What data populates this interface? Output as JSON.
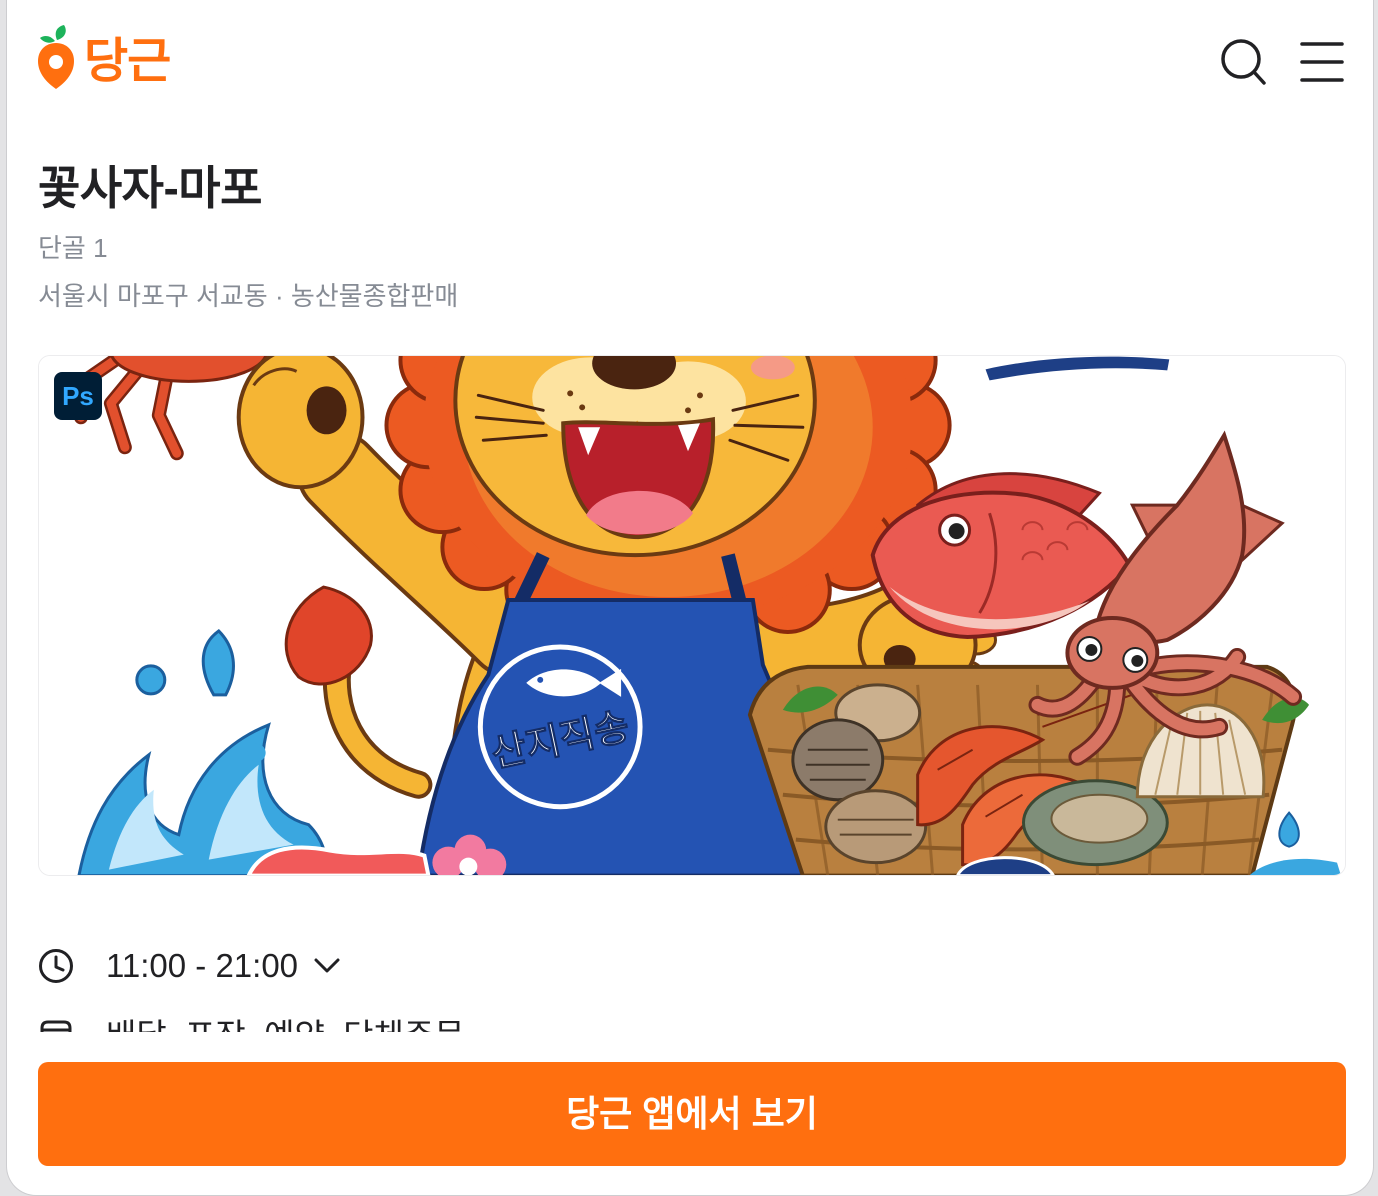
{
  "header": {
    "logo_text": "당근",
    "logo_icon": "carrot-logo-icon",
    "search_icon": "search-icon",
    "menu_icon": "hamburger-menu-icon"
  },
  "store": {
    "name": "꽃사자-마포",
    "regulars": "단골 1",
    "location_category": "서울시 마포구 서교동 · 농산물종합판매"
  },
  "hero_image": {
    "badge": "Ps",
    "apron_text": "산지직송"
  },
  "info": {
    "hours": "11:00 - 21:00",
    "hours_icon": "clock-icon",
    "expand_icon": "chevron-down-icon",
    "services": "배달, 포장, 예약, 단체주문",
    "services_icon": "store-icon"
  },
  "cta": {
    "label": "당근 앱에서 보기"
  },
  "colors": {
    "brand": "#ff6f0f",
    "text_primary": "#212124",
    "text_secondary": "#868b94",
    "photoshop_badge_bg": "#001e36",
    "photoshop_badge_text": "#31a8ff"
  }
}
